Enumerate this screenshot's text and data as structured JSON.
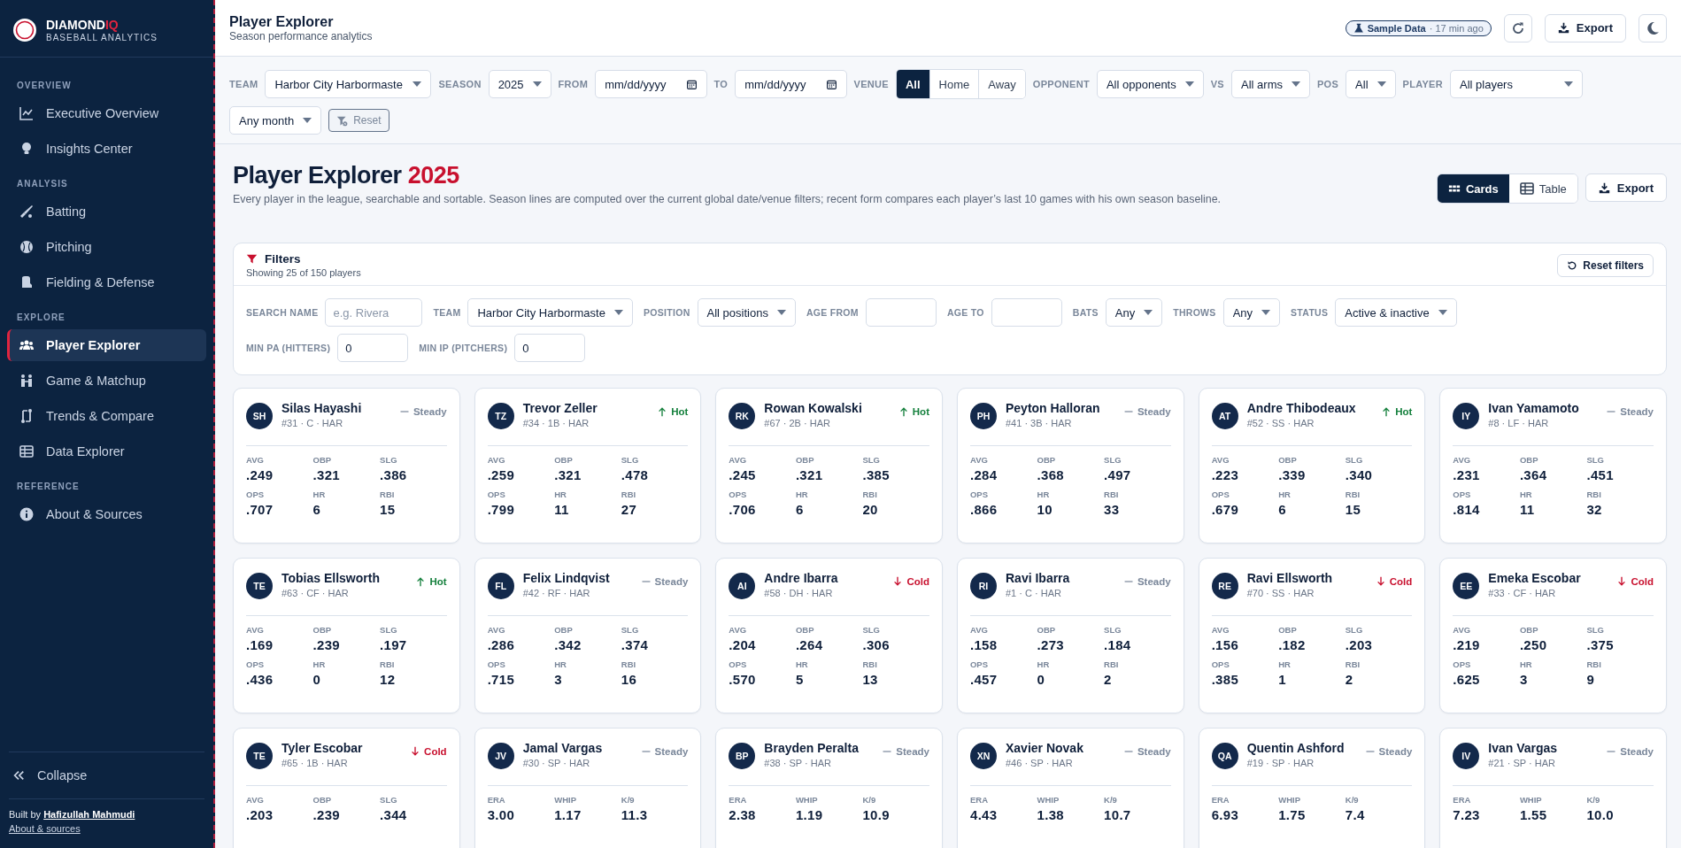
{
  "brand": {
    "name": "DIAMOND",
    "name_accent": "IQ",
    "tagline": "BASEBALL ANALYTICS"
  },
  "sidebar": {
    "sections": [
      {
        "title": "OVERVIEW",
        "items": [
          {
            "label": "Executive Overview",
            "selected": false
          },
          {
            "label": "Insights Center",
            "selected": false
          }
        ]
      },
      {
        "title": "ANALYSIS",
        "items": [
          {
            "label": "Batting",
            "selected": false
          },
          {
            "label": "Pitching",
            "selected": false
          },
          {
            "label": "Fielding & Defense",
            "selected": false
          }
        ]
      },
      {
        "title": "EXPLORE",
        "items": [
          {
            "label": "Player Explorer",
            "selected": true
          },
          {
            "label": "Game & Matchup",
            "selected": false
          },
          {
            "label": "Trends & Compare",
            "selected": false
          },
          {
            "label": "Data Explorer",
            "selected": false
          }
        ]
      },
      {
        "title": "REFERENCE",
        "items": [
          {
            "label": "About & Sources",
            "selected": false
          }
        ]
      }
    ],
    "collapse": "Collapse",
    "built_by": "Built by",
    "author": "Hafizullah Mahmudi",
    "about_link": "About & sources"
  },
  "header": {
    "title": "Player Explorer",
    "subtitle": "Season performance analytics",
    "badge": "Sample Data",
    "badge_age": "· 17 min ago",
    "export": "Export"
  },
  "global_filters": [
    {
      "label": "TEAM",
      "kind": "select",
      "value": "Harbor City Harbormaste"
    },
    {
      "label": "SEASON",
      "kind": "select",
      "value": "2025"
    },
    {
      "label": "FROM",
      "kind": "date",
      "value": "mm/dd/yyyy"
    },
    {
      "label": "TO",
      "kind": "date",
      "value": "mm/dd/yyyy"
    },
    {
      "label": "VENUE",
      "kind": "segmented",
      "options": [
        {
          "label": "All",
          "selected": true
        },
        {
          "label": "Home",
          "selected": false
        },
        {
          "label": "Away",
          "selected": false
        }
      ]
    },
    {
      "label": "OPPONENT",
      "kind": "select",
      "value": "All opponents"
    },
    {
      "label": "VS",
      "kind": "select",
      "value": "All arms"
    },
    {
      "label": "POS",
      "kind": "select",
      "value": "All"
    },
    {
      "label": "PLAYER",
      "kind": "select",
      "value": "All players"
    },
    {
      "kind": "select",
      "value": "Any month"
    }
  ],
  "reset": "Reset",
  "page": {
    "title": "Player Explorer",
    "year": "2025",
    "description": "Every player in the league, searchable and sortable. Season lines are computed over the current global date/venue filters; recent form compares each player’s last 10 games with his own season baseline.",
    "views": [
      {
        "label": "Cards",
        "selected": true
      },
      {
        "label": "Table",
        "selected": false
      }
    ],
    "export": "Export"
  },
  "filters": {
    "title": "Filters",
    "summary": "Showing 25 of 150 players",
    "reset": "Reset filters",
    "fields": [
      {
        "label": "SEARCH NAME",
        "kind": "input",
        "placeholder": "e.g. Rivera"
      },
      {
        "label": "TEAM",
        "kind": "select",
        "value": "Harbor City Harbormaste"
      },
      {
        "label": "POSITION",
        "kind": "select",
        "value": "All positions"
      },
      {
        "label": "AGE FROM",
        "kind": "input"
      },
      {
        "label": "AGE TO",
        "kind": "input"
      },
      {
        "label": "BATS",
        "kind": "select",
        "value": "Any"
      },
      {
        "label": "THROWS",
        "kind": "select",
        "value": "Any"
      },
      {
        "label": "STATUS",
        "kind": "select",
        "value": "Active & inactive"
      },
      {
        "label": "MIN PA (HITTERS)",
        "kind": "input",
        "value": "0"
      },
      {
        "label": "MIN IP (PITCHERS)",
        "kind": "input",
        "value": "0"
      }
    ]
  },
  "players": [
    {
      "initials": "SH",
      "name": "Silas Hayashi",
      "meta": "#31 · C · HAR",
      "trend": {
        "kind": "steady",
        "label": "Steady"
      },
      "stats": [
        [
          [
            "AVG",
            ".249"
          ],
          [
            "OBP",
            ".321"
          ],
          [
            "SLG",
            ".386"
          ]
        ],
        [
          [
            "OPS",
            ".707"
          ],
          [
            "HR",
            "6"
          ],
          [
            "RBI",
            "15"
          ]
        ]
      ]
    },
    {
      "initials": "TZ",
      "name": "Trevor Zeller",
      "meta": "#34 · 1B · HAR",
      "trend": {
        "kind": "hot",
        "label": "Hot"
      },
      "stats": [
        [
          [
            "AVG",
            ".259"
          ],
          [
            "OBP",
            ".321"
          ],
          [
            "SLG",
            ".478"
          ]
        ],
        [
          [
            "OPS",
            ".799"
          ],
          [
            "HR",
            "11"
          ],
          [
            "RBI",
            "27"
          ]
        ]
      ]
    },
    {
      "initials": "RK",
      "name": "Rowan Kowalski",
      "meta": "#67 · 2B · HAR",
      "trend": {
        "kind": "hot",
        "label": "Hot"
      },
      "stats": [
        [
          [
            "AVG",
            ".245"
          ],
          [
            "OBP",
            ".321"
          ],
          [
            "SLG",
            ".385"
          ]
        ],
        [
          [
            "OPS",
            ".706"
          ],
          [
            "HR",
            "6"
          ],
          [
            "RBI",
            "20"
          ]
        ]
      ]
    },
    {
      "initials": "PH",
      "name": "Peyton Halloran",
      "meta": "#41 · 3B · HAR",
      "trend": {
        "kind": "steady",
        "label": "Steady"
      },
      "stats": [
        [
          [
            "AVG",
            ".284"
          ],
          [
            "OBP",
            ".368"
          ],
          [
            "SLG",
            ".497"
          ]
        ],
        [
          [
            "OPS",
            ".866"
          ],
          [
            "HR",
            "10"
          ],
          [
            "RBI",
            "33"
          ]
        ]
      ]
    },
    {
      "initials": "AT",
      "name": "Andre Thibodeaux",
      "meta": "#52 · SS · HAR",
      "trend": {
        "kind": "hot",
        "label": "Hot"
      },
      "stats": [
        [
          [
            "AVG",
            ".223"
          ],
          [
            "OBP",
            ".339"
          ],
          [
            "SLG",
            ".340"
          ]
        ],
        [
          [
            "OPS",
            ".679"
          ],
          [
            "HR",
            "6"
          ],
          [
            "RBI",
            "15"
          ]
        ]
      ]
    },
    {
      "initials": "IY",
      "name": "Ivan Yamamoto",
      "meta": "#8 · LF · HAR",
      "trend": {
        "kind": "steady",
        "label": "Steady"
      },
      "stats": [
        [
          [
            "AVG",
            ".231"
          ],
          [
            "OBP",
            ".364"
          ],
          [
            "SLG",
            ".451"
          ]
        ],
        [
          [
            "OPS",
            ".814"
          ],
          [
            "HR",
            "11"
          ],
          [
            "RBI",
            "32"
          ]
        ]
      ]
    },
    {
      "initials": "TE",
      "name": "Tobias Ellsworth",
      "meta": "#63 · CF · HAR",
      "trend": {
        "kind": "hot",
        "label": "Hot"
      },
      "stats": [
        [
          [
            "AVG",
            ".169"
          ],
          [
            "OBP",
            ".239"
          ],
          [
            "SLG",
            ".197"
          ]
        ],
        [
          [
            "OPS",
            ".436"
          ],
          [
            "HR",
            "0"
          ],
          [
            "RBI",
            "12"
          ]
        ]
      ]
    },
    {
      "initials": "FL",
      "name": "Felix Lindqvist",
      "meta": "#42 · RF · HAR",
      "trend": {
        "kind": "steady",
        "label": "Steady"
      },
      "stats": [
        [
          [
            "AVG",
            ".286"
          ],
          [
            "OBP",
            ".342"
          ],
          [
            "SLG",
            ".374"
          ]
        ],
        [
          [
            "OPS",
            ".715"
          ],
          [
            "HR",
            "3"
          ],
          [
            "RBI",
            "16"
          ]
        ]
      ]
    },
    {
      "initials": "AI",
      "name": "Andre Ibarra",
      "meta": "#58 · DH · HAR",
      "trend": {
        "kind": "cold",
        "label": "Cold"
      },
      "stats": [
        [
          [
            "AVG",
            ".204"
          ],
          [
            "OBP",
            ".264"
          ],
          [
            "SLG",
            ".306"
          ]
        ],
        [
          [
            "OPS",
            ".570"
          ],
          [
            "HR",
            "5"
          ],
          [
            "RBI",
            "13"
          ]
        ]
      ]
    },
    {
      "initials": "RI",
      "name": "Ravi Ibarra",
      "meta": "#1 · C · HAR",
      "trend": {
        "kind": "steady",
        "label": "Steady"
      },
      "stats": [
        [
          [
            "AVG",
            ".158"
          ],
          [
            "OBP",
            ".273"
          ],
          [
            "SLG",
            ".184"
          ]
        ],
        [
          [
            "OPS",
            ".457"
          ],
          [
            "HR",
            "0"
          ],
          [
            "RBI",
            "2"
          ]
        ]
      ]
    },
    {
      "initials": "RE",
      "name": "Ravi Ellsworth",
      "meta": "#70 · SS · HAR",
      "trend": {
        "kind": "cold",
        "label": "Cold"
      },
      "stats": [
        [
          [
            "AVG",
            ".156"
          ],
          [
            "OBP",
            ".182"
          ],
          [
            "SLG",
            ".203"
          ]
        ],
        [
          [
            "OPS",
            ".385"
          ],
          [
            "HR",
            "1"
          ],
          [
            "RBI",
            "2"
          ]
        ]
      ]
    },
    {
      "initials": "EE",
      "name": "Emeka Escobar",
      "meta": "#33 · CF · HAR",
      "trend": {
        "kind": "cold",
        "label": "Cold"
      },
      "stats": [
        [
          [
            "AVG",
            ".219"
          ],
          [
            "OBP",
            ".250"
          ],
          [
            "SLG",
            ".375"
          ]
        ],
        [
          [
            "OPS",
            ".625"
          ],
          [
            "HR",
            "3"
          ],
          [
            "RBI",
            "9"
          ]
        ]
      ]
    },
    {
      "initials": "TE",
      "name": "Tyler Escobar",
      "meta": "#65 · 1B · HAR",
      "trend": {
        "kind": "cold",
        "label": "Cold"
      },
      "stats": [
        [
          [
            "AVG",
            ".203"
          ],
          [
            "OBP",
            ".239"
          ],
          [
            "SLG",
            ".344"
          ]
        ]
      ]
    },
    {
      "initials": "JV",
      "name": "Jamal Vargas",
      "meta": "#30 · SP · HAR",
      "trend": {
        "kind": "steady",
        "label": "Steady"
      },
      "stats": [
        [
          [
            "ERA",
            "3.00"
          ],
          [
            "WHIP",
            "1.17"
          ],
          [
            "K/9",
            "11.3"
          ]
        ]
      ]
    },
    {
      "initials": "BP",
      "name": "Brayden Peralta",
      "meta": "#38 · SP · HAR",
      "trend": {
        "kind": "steady",
        "label": "Steady"
      },
      "stats": [
        [
          [
            "ERA",
            "2.38"
          ],
          [
            "WHIP",
            "1.19"
          ],
          [
            "K/9",
            "10.9"
          ]
        ]
      ]
    },
    {
      "initials": "XN",
      "name": "Xavier Novak",
      "meta": "#46 · SP · HAR",
      "trend": {
        "kind": "steady",
        "label": "Steady"
      },
      "stats": [
        [
          [
            "ERA",
            "4.43"
          ],
          [
            "WHIP",
            "1.38"
          ],
          [
            "K/9",
            "10.7"
          ]
        ]
      ]
    },
    {
      "initials": "QA",
      "name": "Quentin Ashford",
      "meta": "#19 · SP · HAR",
      "trend": {
        "kind": "steady",
        "label": "Steady"
      },
      "stats": [
        [
          [
            "ERA",
            "6.93"
          ],
          [
            "WHIP",
            "1.75"
          ],
          [
            "K/9",
            "7.4"
          ]
        ]
      ]
    },
    {
      "initials": "IV",
      "name": "Ivan Vargas",
      "meta": "#21 · SP · HAR",
      "trend": {
        "kind": "steady",
        "label": "Steady"
      },
      "stats": [
        [
          [
            "ERA",
            "7.23"
          ],
          [
            "WHIP",
            "1.55"
          ],
          [
            "K/9",
            "10.0"
          ]
        ]
      ]
    }
  ]
}
